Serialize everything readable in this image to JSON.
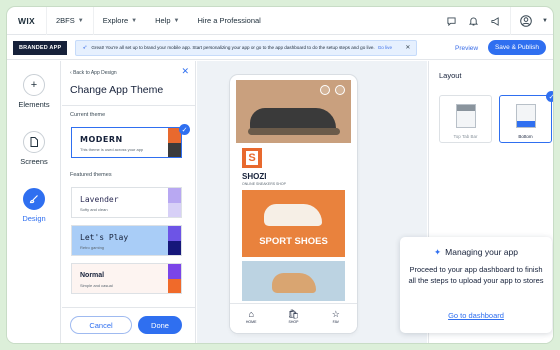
{
  "topbar": {
    "logo": "WIX",
    "site_name": "2BFS",
    "menu": [
      "Explore",
      "Help",
      "Hire a Professional"
    ]
  },
  "secondbar": {
    "badge": "BRANDED APP",
    "banner_text": "Great! You're all set up to brand your mobile app. Start personalizing your app or go to the app dashboard to do the setup steps and go live.",
    "banner_link": "Go live",
    "preview_label": "Preview",
    "publish_label": "Save & Publish"
  },
  "rail": {
    "items": [
      {
        "label": "Elements",
        "icon": "plus-icon"
      },
      {
        "label": "Screens",
        "icon": "page-icon"
      },
      {
        "label": "Design",
        "icon": "brush-icon"
      }
    ]
  },
  "panel": {
    "back_label": "Back to App Design",
    "title": "Change App Theme",
    "current_label": "Current theme",
    "featured_label": "Featured themes",
    "current": {
      "name": "MODERN",
      "sub": "This theme is used across your app"
    },
    "themes": [
      {
        "name": "Lavender",
        "sub": "Softy and clean",
        "bg": "#ffffff",
        "colors": [
          "#b8a8f2",
          "#d7d0f7"
        ]
      },
      {
        "name": "Let's Play",
        "sub": "Retro gaming",
        "bg": "#a9cdf7",
        "colors": [
          "#6d54e6",
          "#16177a"
        ]
      },
      {
        "name": "Normal",
        "sub": "Simple and casual",
        "bg": "#fdf4f1",
        "colors": [
          "#7b45e8",
          "#f06a2a"
        ]
      }
    ],
    "cancel_label": "Cancel",
    "done_label": "Done"
  },
  "phone": {
    "store_name": "SHOZI",
    "store_sub": "ONLINE SNEAKERS SHOP",
    "promo_label": "SPORT SHOES",
    "tabs": [
      "HOME",
      "SHOP",
      "FAV"
    ]
  },
  "layout": {
    "title": "Layout",
    "options": [
      {
        "label": "Top Tab Bar",
        "selected": false
      },
      {
        "label": "Bottom",
        "selected": true
      }
    ]
  },
  "card": {
    "title": "Managing your app",
    "body": "Proceed to your app dashboard to finish all the steps to upload your app to stores",
    "link": "Go to dashboard"
  }
}
